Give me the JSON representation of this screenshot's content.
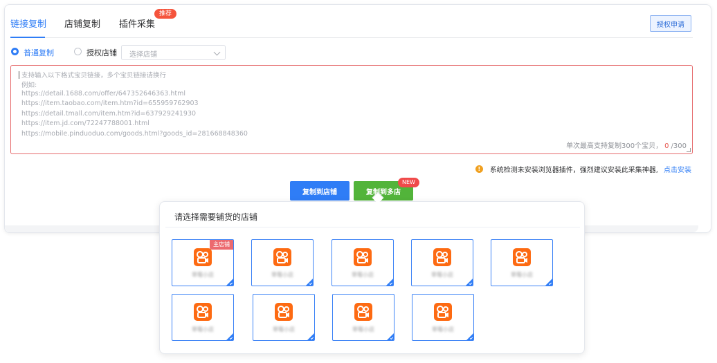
{
  "tabs": [
    {
      "label": "链接复制",
      "active": true
    },
    {
      "label": "店铺复制",
      "active": false
    },
    {
      "label": "插件采集",
      "active": false,
      "badge": "推荐"
    }
  ],
  "auth_button": "授权申请",
  "copy_mode": {
    "options": [
      {
        "label": "普通复制",
        "checked": true
      },
      {
        "label": "授权店铺",
        "checked": false
      }
    ],
    "select_placeholder": "选择店铺"
  },
  "textarea": {
    "placeholder_lines": [
      "支持输入以下格式宝贝链接，多个宝贝链接请换行",
      "例如:",
      "https://detail.1688.com/offer/647352646363.html",
      "https://item.taobao.com/item.htm?id=655959762903",
      "https://detail.tmall.com/item.htm?id=637929241930",
      "https://item.jd.com/72247788001.html",
      "https://mobile.pinduoduo.com/goods.html?goods_id=281668848360"
    ],
    "limit_text": "单次最高支持复制300个宝贝，",
    "count": "0",
    "max": "/300"
  },
  "notice": {
    "text": "系统检测未安装浏览器插件，强烈建议安装此采集神器,",
    "link": "点击安装"
  },
  "buttons": {
    "copy_to_shop": "复制到店铺",
    "copy_to_multi": "复制到多店",
    "new_badge": "NEW"
  },
  "popover": {
    "title": "请选择需要铺货的店铺",
    "shops": [
      {
        "name": "草莓小店",
        "tag": "主店铺",
        "selected": true
      },
      {
        "name": "草莓小店",
        "selected": true
      },
      {
        "name": "草莓小店",
        "selected": true
      },
      {
        "name": "草莓小店",
        "selected": true
      },
      {
        "name": "草莓小店",
        "selected": true
      },
      {
        "name": "草莓小店",
        "selected": true
      },
      {
        "name": "草莓小店",
        "selected": true
      },
      {
        "name": "草莓小店",
        "selected": true
      },
      {
        "name": "草莓小店",
        "selected": true
      }
    ]
  },
  "colors": {
    "primary": "#2f7df6",
    "success": "#52b43a",
    "danger": "#e5534b",
    "shop_logo": "#fd6a12"
  }
}
